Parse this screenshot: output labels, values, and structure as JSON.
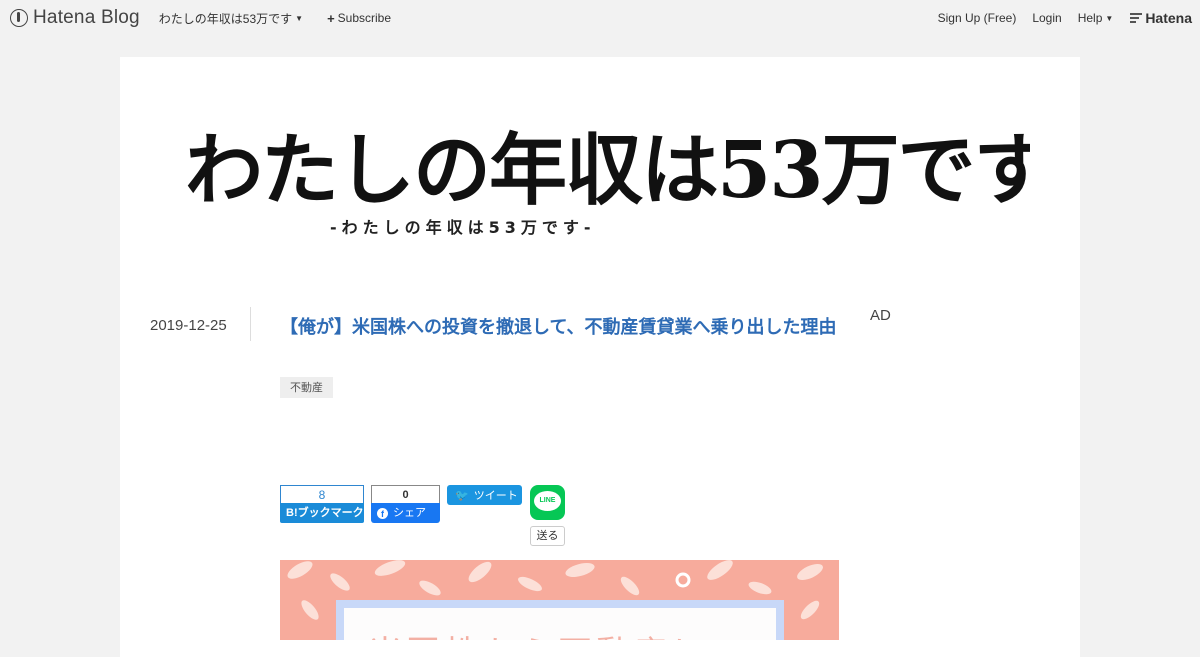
{
  "header": {
    "logo_text": "Hatena Blog",
    "blog_name": "わたしの年収は53万です",
    "subscribe_label": "Subscribe",
    "signup_label": "Sign Up (Free)",
    "login_label": "Login",
    "help_label": "Help",
    "hatena_label": "Hatena"
  },
  "blog": {
    "title_main": "わたしの年収は53万です",
    "title_sub": "-わたしの年収は53万です-"
  },
  "entry": {
    "date": "2019-12-25",
    "title": "【俺が】米国株への投資を撤退して、不動産賃貸業へ乗り出した理由",
    "category": "不動産",
    "eyecatch_text": "米国株から不動産に"
  },
  "sidebar": {
    "ad_label": "AD"
  },
  "share": {
    "hatebu_count": "8",
    "hatebu_label": "B!ブックマーク",
    "facebook_count": "0",
    "facebook_label": "シェア",
    "twitter_label": "ツイート",
    "line_icon_text": "LINE",
    "line_label": "送る"
  },
  "colors": {
    "link": "#2e6bb5",
    "hatebu": "#1a8bd8",
    "facebook": "#1877f2",
    "twitter": "#1b95e0",
    "line": "#06c755",
    "eyecatch_bg": "#f7ab9c"
  }
}
